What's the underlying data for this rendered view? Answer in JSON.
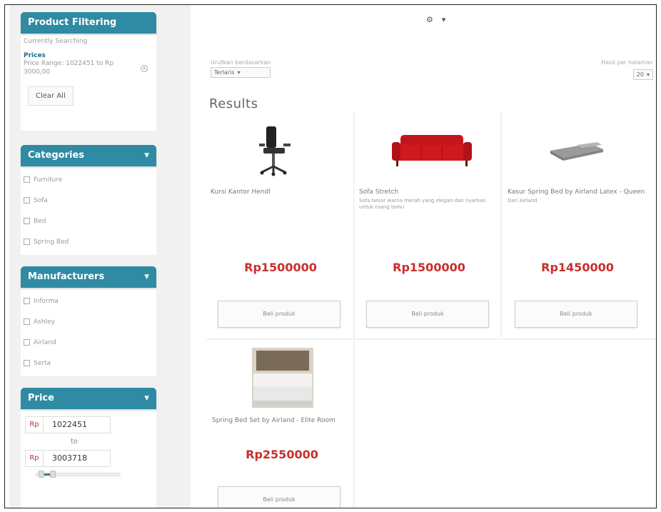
{
  "sidebar": {
    "filtering": {
      "title": "Product Filtering",
      "current_search_label": "Currently Searching",
      "filter_key": "Prices",
      "filter_value": "Price Range: 1022451 to Rp 3000,00",
      "clear_all": "Clear All"
    },
    "categories": {
      "title": "Categories",
      "items": [
        "Furniture",
        "Sofa",
        "Bed",
        "Spring Bed"
      ]
    },
    "manufacturers": {
      "title": "Manufacturers",
      "items": [
        "Informa",
        "Ashley",
        "Airland",
        "Serta"
      ]
    },
    "price": {
      "title": "Price",
      "currency": "Rp",
      "min": "1022451",
      "to_label": "to",
      "max": "3003718",
      "slider_low": 0.07,
      "slider_high": 0.2
    }
  },
  "main": {
    "top_icons": [
      "settings-icon",
      "chevron-down-icon"
    ],
    "sort": {
      "label": "Urutkan berdasarkan",
      "value": "Terlaris",
      "arrow": "▾"
    },
    "per_page": {
      "label": "Hasil per halaman",
      "value": "20"
    },
    "results_title": "Results",
    "products": [
      {
        "name": "Kursi Kantor Hendl",
        "desc": "",
        "price": "Rp1500000",
        "button": "Beli produk",
        "image": "office-chair-image"
      },
      {
        "name": "Sofa Stretch",
        "desc": "Sofa besar warna merah yang elegan dan nyaman untuk ruang tamu",
        "price": "Rp1500000",
        "button": "Beli produk",
        "image": "red-sofa-image"
      },
      {
        "name": "Kasur Spring Bed by Airland Latex - Queen",
        "desc": "Dari Airland",
        "price": "Rp1450000",
        "button": "Beli produk",
        "image": "mattress-image"
      },
      {
        "name": "Spring Bed Set by Airland - Elite Room",
        "desc": "",
        "price": "Rp2550000",
        "button": "Beli produk",
        "image": "spring-bed-image"
      }
    ]
  },
  "colors": {
    "accent": "#2f8aa3",
    "price": "#c8302a"
  }
}
